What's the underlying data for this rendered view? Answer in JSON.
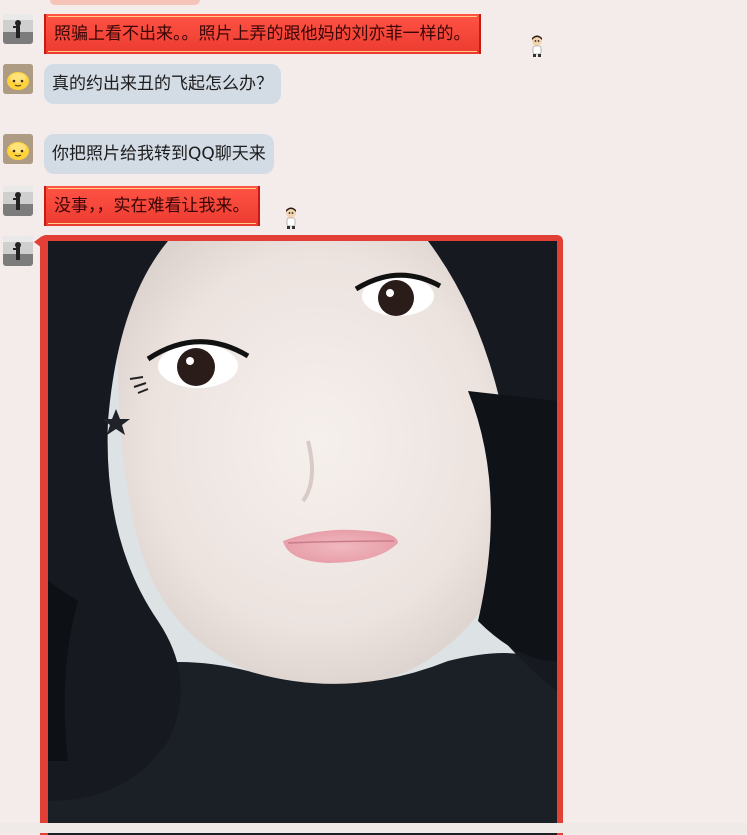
{
  "messages": [
    {
      "sender": "self",
      "style": "red",
      "text": "照骗上看不出来。。照片上弄的跟他妈的刘亦菲一样的。"
    },
    {
      "sender": "friend",
      "style": "grey",
      "text": "真的约出来丑的飞起怎么办？"
    },
    {
      "sender": "friend",
      "style": "grey",
      "text": "你把照片给我转到QQ聊天来"
    },
    {
      "sender": "self",
      "style": "red",
      "text": "没事，，实在难看让我来。"
    },
    {
      "sender": "self",
      "style": "photo",
      "image_description": "selfie-photo"
    }
  ],
  "colors": {
    "background": "#f4eceb",
    "grey_bubble": "#d3dbe5",
    "red_bubble": "#ec3a30",
    "photo_frame": "#e24037"
  },
  "icons": {
    "self_avatar": "silhouette-avatar-icon",
    "friend_avatar": "yellow-face-avatar-icon",
    "bubble_sticker": "cartoon-boy-sticker-icon"
  }
}
